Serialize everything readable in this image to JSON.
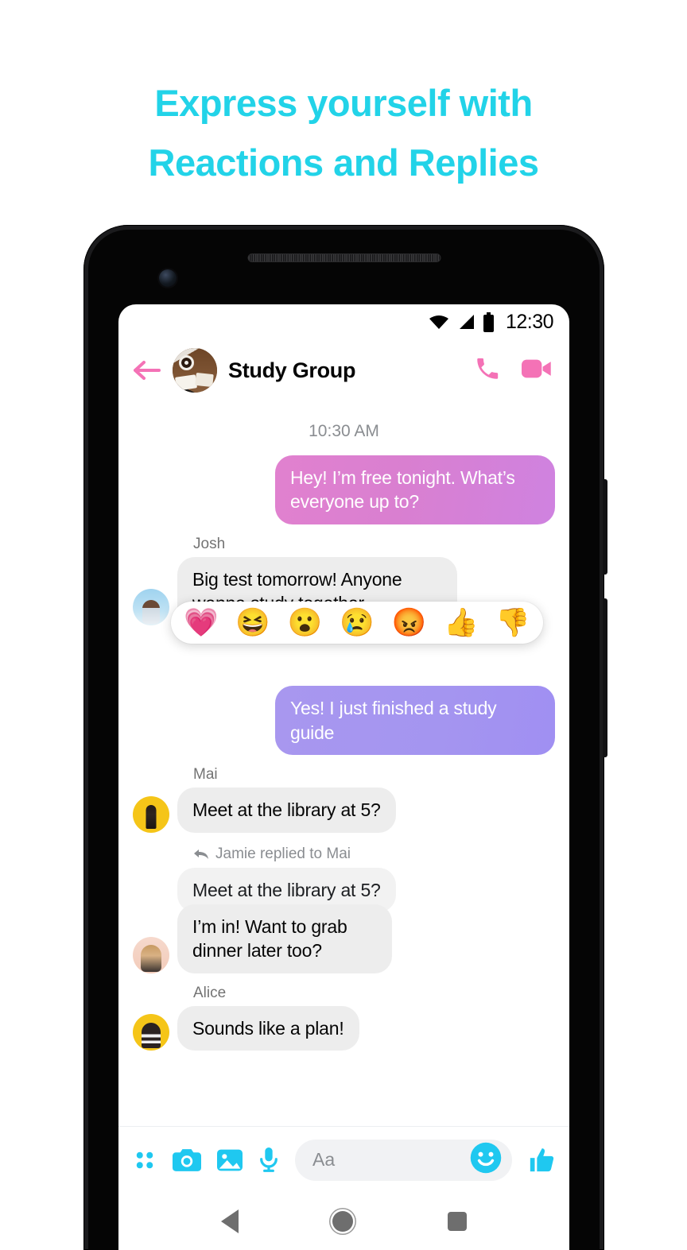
{
  "headline": {
    "line1": "Express yourself with",
    "line2": "Reactions and Replies",
    "color": "#22D3E8"
  },
  "status_bar": {
    "time": "12:30",
    "wifi_icon": "wifi-icon",
    "signal_icon": "cellular-signal-icon",
    "battery_icon": "battery-full-icon"
  },
  "chat_header": {
    "back_icon": "back-arrow-icon",
    "avatar_icon": "group-avatar",
    "title": "Study Group",
    "call_icon": "phone-call-icon",
    "video_icon": "video-call-icon",
    "accent_color": "#F472B6"
  },
  "conversation": {
    "timestamp": "10:30 AM",
    "messages": [
      {
        "id": "m1",
        "direction": "outgoing",
        "style": "pink",
        "text": "Hey! I’m free tonight. What’s everyone up to?"
      },
      {
        "id": "m2",
        "direction": "incoming",
        "style": "gray",
        "sender": "Josh",
        "avatar": "josh",
        "text": "Big test tomorrow! Anyone wanna study together"
      },
      {
        "id": "m3",
        "direction": "outgoing",
        "style": "purple",
        "text": "Yes! I just finished a study guide"
      },
      {
        "id": "m4",
        "direction": "incoming",
        "style": "gray",
        "sender": "Mai",
        "avatar": "mai",
        "text": "Meet at the library at 5?"
      },
      {
        "id": "m5",
        "direction": "incoming",
        "style": "reply",
        "reply_label": "Jamie replied to Mai",
        "quoted_text": "Meet at the library at 5?",
        "avatar": "jamie",
        "text": "I’m in! Want to grab dinner later too?"
      },
      {
        "id": "m6",
        "direction": "incoming",
        "style": "gray",
        "sender": "Alice",
        "avatar": "alice",
        "text": "Sounds like a plan!"
      }
    ]
  },
  "reaction_bar": {
    "attached_to": "m2",
    "reactions": [
      {
        "name": "heart-reaction",
        "glyph": "💗"
      },
      {
        "name": "haha-reaction",
        "glyph": "😆"
      },
      {
        "name": "wow-reaction",
        "glyph": "😮"
      },
      {
        "name": "sad-reaction",
        "glyph": "😢"
      },
      {
        "name": "angry-reaction",
        "glyph": "😡"
      },
      {
        "name": "thumbs-up-reaction",
        "glyph": "👍"
      },
      {
        "name": "thumbs-down-reaction",
        "glyph": "👎"
      }
    ]
  },
  "composer": {
    "accent_color": "#1FC8F0",
    "apps_icon": "apps-grid-icon",
    "camera_icon": "camera-icon",
    "gallery_icon": "gallery-image-icon",
    "mic_icon": "microphone-icon",
    "input_placeholder": "Aa",
    "input_value": "",
    "emoji_icon": "emoji-smiley-icon",
    "like_icon": "thumbs-up-icon"
  },
  "android_nav": {
    "back": "nav-back-button",
    "home": "nav-home-button",
    "recents": "nav-recents-button"
  }
}
